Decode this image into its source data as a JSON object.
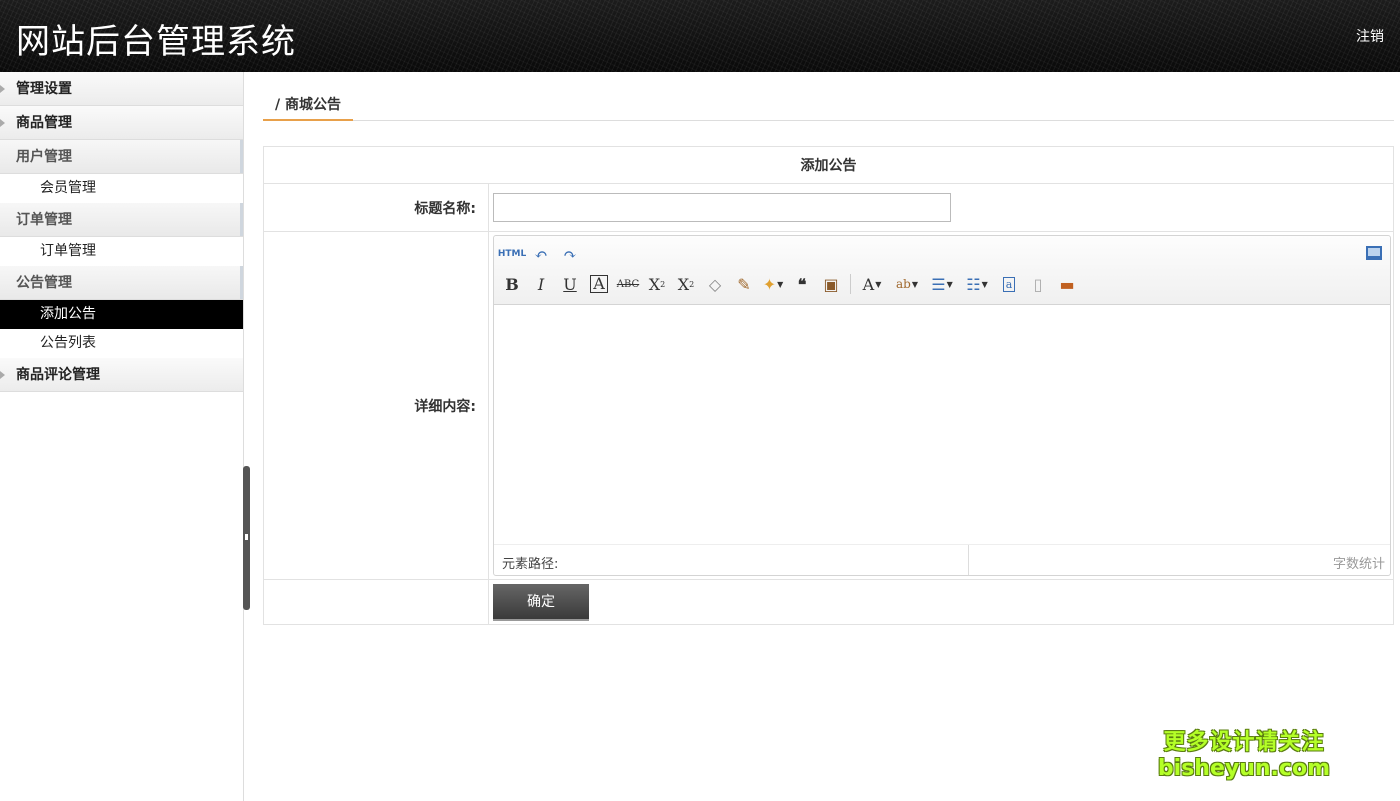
{
  "header": {
    "title": "网站后台管理系统",
    "logout_label": "注销"
  },
  "sidebar": {
    "groups": [
      {
        "label": "管理设置",
        "open": false,
        "items": []
      },
      {
        "label": "商品管理",
        "open": false,
        "items": []
      },
      {
        "label": "用户管理",
        "open": true,
        "items": [
          {
            "label": "会员管理",
            "active": false
          }
        ]
      },
      {
        "label": "订单管理",
        "open": true,
        "items": [
          {
            "label": "订单管理",
            "active": false
          }
        ]
      },
      {
        "label": "公告管理",
        "open": true,
        "items": [
          {
            "label": "添加公告",
            "active": true
          },
          {
            "label": "公告列表",
            "active": false
          }
        ]
      },
      {
        "label": "商品评论管理",
        "open": false,
        "items": []
      }
    ]
  },
  "breadcrumb": {
    "label": "/ 商城公告"
  },
  "form": {
    "caption": "添加公告",
    "title_label": "标题名称:",
    "title_value": "",
    "content_label": "详细内容:",
    "submit_label": "确定"
  },
  "editor": {
    "toolbar_row1": [
      "html-icon",
      "undo-icon",
      "redo-icon"
    ],
    "toolbar_row2": [
      "bold-icon",
      "italic-icon",
      "underline-icon",
      "font-border-icon",
      "strikethrough-icon",
      "superscript-icon",
      "subscript-icon",
      "remove-format-icon",
      "format-painter-icon",
      "auto-typeset-icon",
      "blockquote-icon",
      "paste-plain-icon",
      "font-color-icon",
      "background-color-icon",
      "ordered-list-icon",
      "unordered-list-icon",
      "select-all-icon",
      "clear-doc-icon",
      "insert-image-icon"
    ],
    "html_text": "HTML",
    "path_label": "元素路径:",
    "word_count_label": "字数统计"
  },
  "watermark": {
    "line1": "更多设计请关注",
    "line2": "bisheyun.com"
  },
  "colors": {
    "header_bg": "#111111",
    "active_item_bg": "#000000",
    "tab_underline": "#e8a04a",
    "submit_bg": "#4a4a4a",
    "watermark": "#b4ff27"
  }
}
